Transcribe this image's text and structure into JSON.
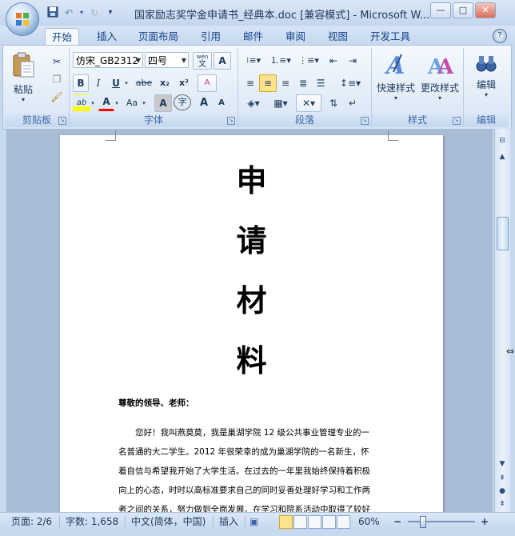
{
  "window": {
    "title": "国家励志奖学金申请书_经典本.doc [兼容模式] - Microsoft W...",
    "controls": {
      "minimize": "—",
      "maximize": "□",
      "close": "✕"
    }
  },
  "qat": {
    "save_icon": "save-icon",
    "undo_icon": "undo-icon",
    "redo_icon": "redo-icon",
    "customize": "▾"
  },
  "tabs": [
    "开始",
    "插入",
    "页面布局",
    "引用",
    "邮件",
    "审阅",
    "视图",
    "开发工具"
  ],
  "active_tab": "开始",
  "ribbon": {
    "clipboard": {
      "label": "剪贴板",
      "paste": "粘贴"
    },
    "font": {
      "label": "字体",
      "font_name": "仿宋_GB2312",
      "font_size": "四号",
      "wen": "wén",
      "wen_char": "文",
      "A_box": "A",
      "bold": "B",
      "italic": "I",
      "underline": "U",
      "strike": "abe",
      "subscript": "x₂",
      "superscript": "x²",
      "clear": "A",
      "highlight": "ab",
      "font_color": "A",
      "case": "Aa",
      "char_shade": "A",
      "enclose": "字",
      "grow": "A",
      "shrink": "A"
    },
    "paragraph": {
      "label": "段落"
    },
    "styles": {
      "label": "样式",
      "quick": "快速样式",
      "change": "更改样式"
    },
    "edit": {
      "label": "编辑",
      "btn": "编辑"
    }
  },
  "document": {
    "title_chars": [
      "申",
      "请",
      "材",
      "料"
    ],
    "greeting": "尊敬的领导、老师：",
    "paragraph_lines": [
      "　　您好！我叫燕莫莫，我是巢湖学院 12 级公共事业管理专业的一",
      "名普通的大二学生。2012 年很荣幸的成为巢湖学院的一名新生，怀",
      "着自信与希望我开始了大学生活。在过去的一年里我始终保持着积极",
      "向上的心态，时时以高标准要求自己的同时妥善处理好学习和工作两",
      "者之间的关系，努力做到全面发展。在学习和院系活动中取得了较好"
    ]
  },
  "statusbar": {
    "page": "页面: 2/6",
    "words": "字数: 1,658",
    "language": "中文(简体，中国)",
    "insert": "插入",
    "zoom": "60%",
    "zoom_level": 0.18,
    "minus": "−",
    "plus": "+"
  },
  "colors": {
    "accent": "#15428b",
    "highlight": "#ffff00",
    "font_color": "#ff0000"
  }
}
